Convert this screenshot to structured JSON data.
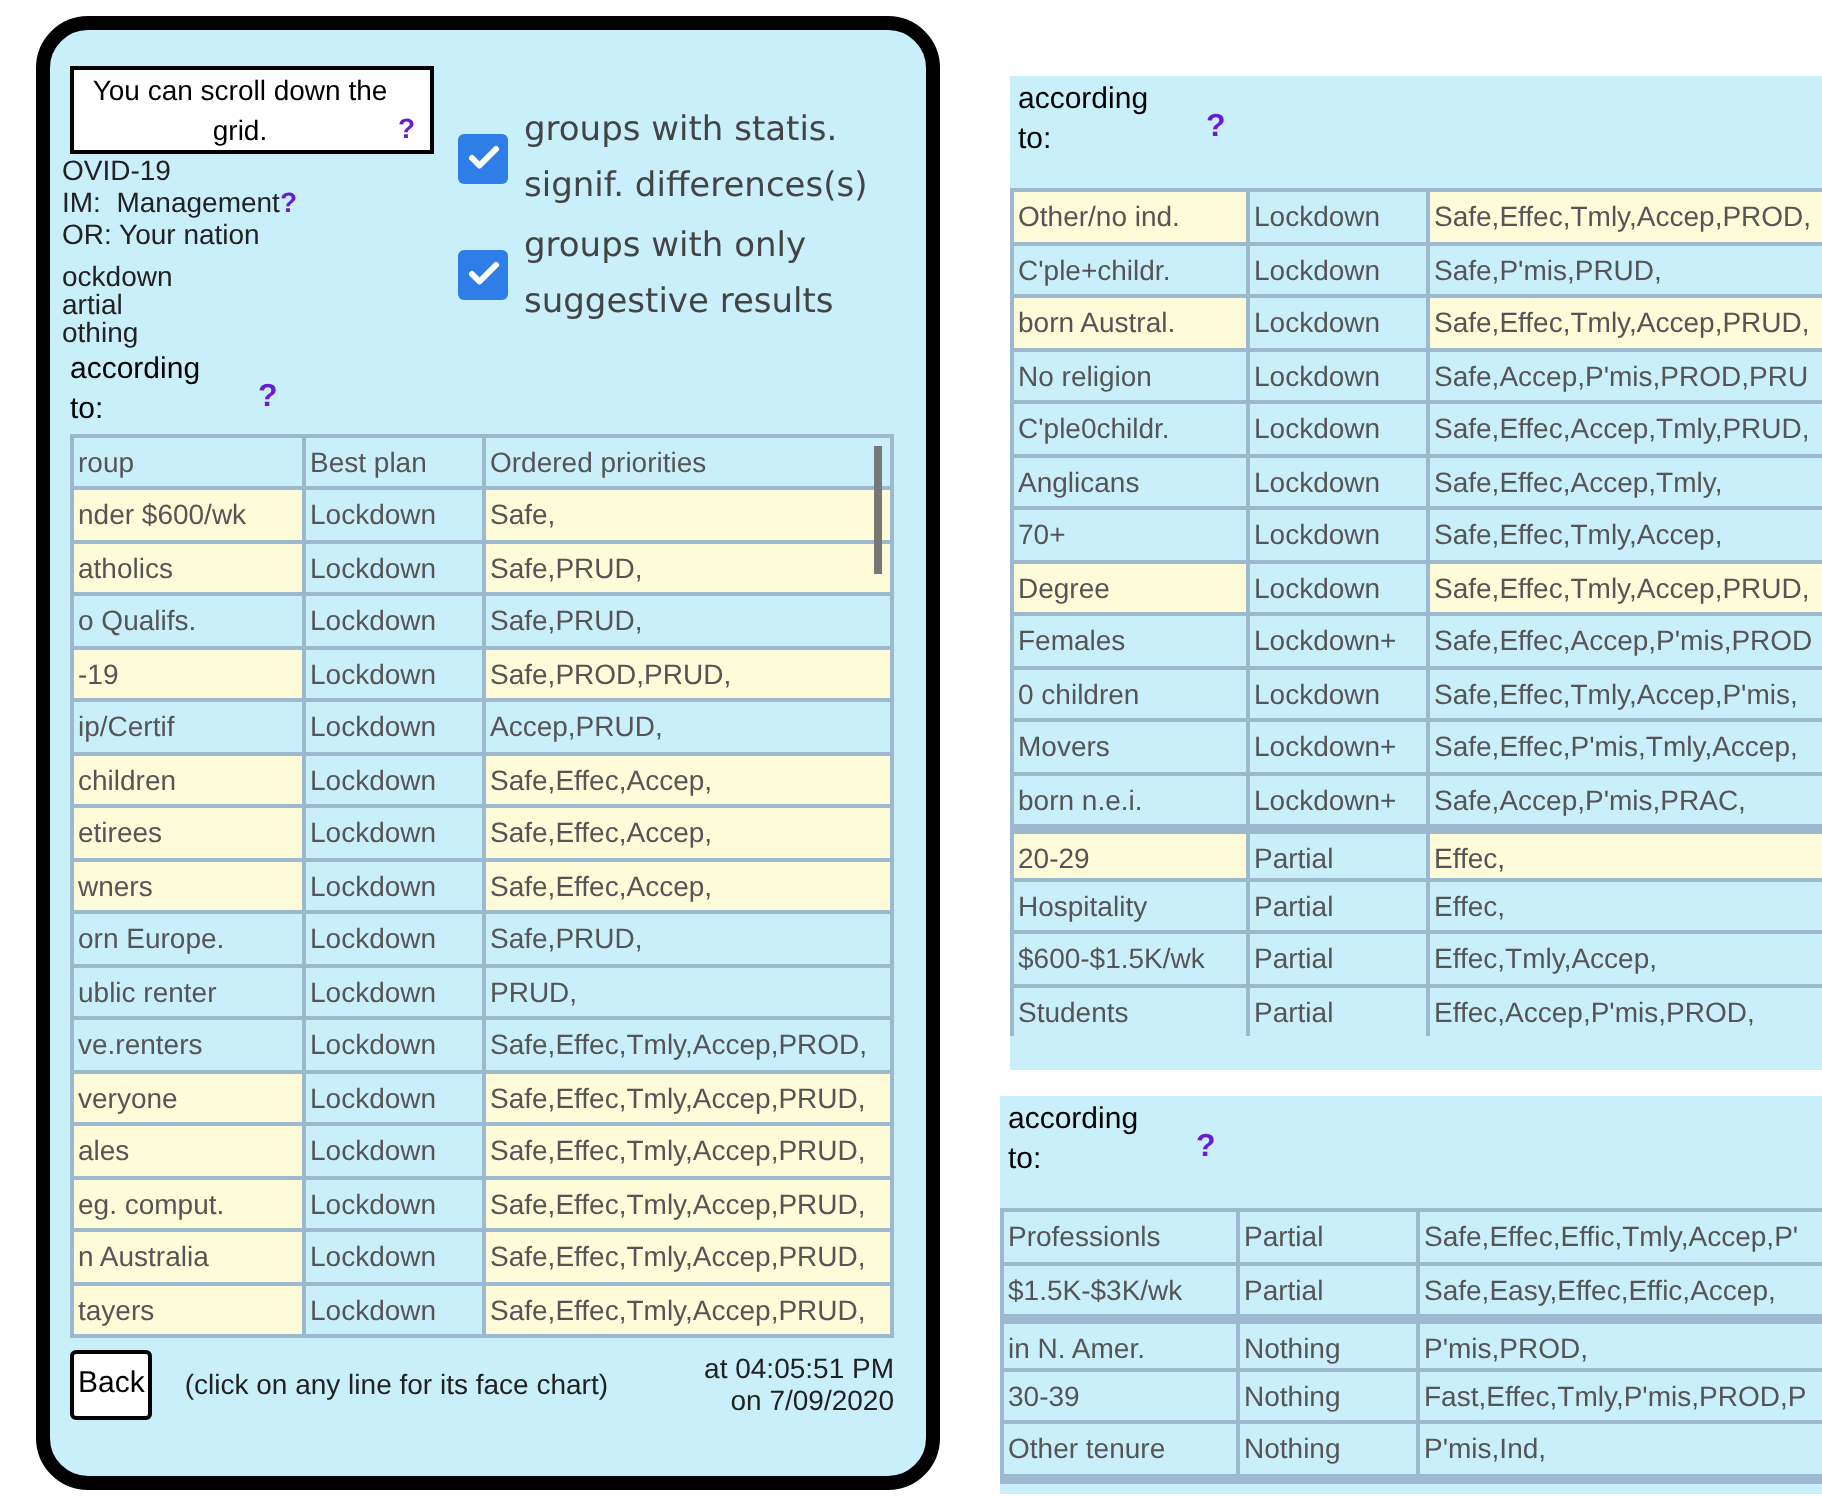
{
  "left_panel": {
    "notice": {
      "text": "You can scroll down the grid.",
      "help": "?"
    },
    "info": [
      {
        "text": "OVID-19"
      },
      {
        "text": "IM:  Management",
        "help": "?"
      },
      {
        "text": "OR: Your nation"
      }
    ],
    "plans": [
      "ockdown",
      "artial",
      "othing"
    ],
    "checkboxes": [
      {
        "label": "groups with statis. signif. differences(s)",
        "checked": true
      },
      {
        "label": "groups with only suggestive results",
        "checked": true
      }
    ],
    "according": {
      "text": "according to:",
      "help": "?"
    },
    "table": {
      "columns": [
        "roup",
        "Best plan",
        "Ordered priorities"
      ],
      "rows": [
        {
          "cells": [
            "nder $600/wk",
            "Lockdown",
            "Safe,"
          ],
          "highlighted": true
        },
        {
          "cells": [
            "atholics",
            "Lockdown",
            "Safe,PRUD,"
          ],
          "highlighted": true
        },
        {
          "cells": [
            "o Qualifs.",
            "Lockdown",
            "Safe,PRUD,"
          ],
          "highlighted": false
        },
        {
          "cells": [
            "-19",
            "Lockdown",
            "Safe,PROD,PRUD,"
          ],
          "highlighted": true
        },
        {
          "cells": [
            "ip/Certif",
            "Lockdown",
            "Accep,PRUD,"
          ],
          "highlighted": false
        },
        {
          "cells": [
            "children",
            "Lockdown",
            "Safe,Effec,Accep,"
          ],
          "highlighted": true
        },
        {
          "cells": [
            "etirees",
            "Lockdown",
            "Safe,Effec,Accep,"
          ],
          "highlighted": true
        },
        {
          "cells": [
            "wners",
            "Lockdown",
            "Safe,Effec,Accep,"
          ],
          "highlighted": true
        },
        {
          "cells": [
            "orn Europe.",
            "Lockdown",
            "Safe,PRUD,"
          ],
          "highlighted": false
        },
        {
          "cells": [
            "ublic renter",
            "Lockdown",
            "PRUD,"
          ],
          "highlighted": false
        },
        {
          "cells": [
            "ve.renters",
            "Lockdown",
            "Safe,Effec,Tmly,Accep,PROD,"
          ],
          "highlighted": false
        },
        {
          "cells": [
            "veryone",
            "Lockdown",
            "Safe,Effec,Tmly,Accep,PRUD,"
          ],
          "highlighted": true
        },
        {
          "cells": [
            "ales",
            "Lockdown",
            "Safe,Effec,Tmly,Accep,PRUD,"
          ],
          "highlighted": true
        },
        {
          "cells": [
            "eg. comput.",
            "Lockdown",
            "Safe,Effec,Tmly,Accep,PRUD,"
          ],
          "highlighted": true
        },
        {
          "cells": [
            "n Australia",
            "Lockdown",
            "Safe,Effec,Tmly,Accep,PRUD,"
          ],
          "highlighted": true
        },
        {
          "cells": [
            "tayers",
            "Lockdown",
            "Safe,Effec,Tmly,Accep,PRUD,"
          ],
          "highlighted": true
        }
      ]
    },
    "footer": {
      "button": "Back",
      "hint": "(click on any line for its face chart)",
      "time": "at 04:05:51 PM",
      "date": "on 7/09/2020"
    }
  },
  "right_top": {
    "according": {
      "text": "according to:",
      "help": "?"
    },
    "rows": [
      {
        "cells": [
          "Other/no ind.",
          "Lockdown",
          "Safe,Effec,Tmly,Accep,PROD,"
        ],
        "highlighted": true,
        "separator_before": false
      },
      {
        "cells": [
          "C'ple+childr.",
          "Lockdown",
          "Safe,P'mis,PRUD,"
        ],
        "highlighted": false,
        "separator_before": false
      },
      {
        "cells": [
          "born Austral.",
          "Lockdown",
          "Safe,Effec,Tmly,Accep,PRUD,"
        ],
        "highlighted": true,
        "separator_before": false
      },
      {
        "cells": [
          "No religion",
          "Lockdown",
          "Safe,Accep,P'mis,PROD,PRU"
        ],
        "highlighted": false,
        "separator_before": false
      },
      {
        "cells": [
          "C'ple0childr.",
          "Lockdown",
          "Safe,Effec,Accep,Tmly,PRUD,"
        ],
        "highlighted": false,
        "separator_before": false
      },
      {
        "cells": [
          "Anglicans",
          "Lockdown",
          "Safe,Effec,Accep,Tmly,"
        ],
        "highlighted": false,
        "separator_before": false
      },
      {
        "cells": [
          "70+",
          "Lockdown",
          "Safe,Effec,Tmly,Accep,"
        ],
        "highlighted": false,
        "separator_before": false
      },
      {
        "cells": [
          "Degree",
          "Lockdown",
          "Safe,Effec,Tmly,Accep,PRUD,"
        ],
        "highlighted": true,
        "separator_before": false
      },
      {
        "cells": [
          "Females",
          "Lockdown+",
          "Safe,Effec,Accep,P'mis,PROD"
        ],
        "highlighted": false,
        "separator_before": false
      },
      {
        "cells": [
          "0 children",
          "Lockdown",
          "Safe,Effec,Tmly,Accep,P'mis,"
        ],
        "highlighted": false,
        "separator_before": false
      },
      {
        "cells": [
          "Movers",
          "Lockdown+",
          "Safe,Effec,P'mis,Tmly,Accep,"
        ],
        "highlighted": false,
        "separator_before": false
      },
      {
        "cells": [
          "born n.e.i.",
          "Lockdown+",
          "Safe,Accep,P'mis,PRAC,"
        ],
        "highlighted": false,
        "separator_before": false
      },
      {
        "cells": [
          "20-29",
          "Partial",
          "Effec,"
        ],
        "highlighted": true,
        "separator_before": true
      },
      {
        "cells": [
          "Hospitality",
          "Partial",
          "Effec,"
        ],
        "highlighted": false,
        "separator_before": false
      },
      {
        "cells": [
          "$600-$1.5K/wk",
          "Partial",
          "Effec,Tmly,Accep,"
        ],
        "highlighted": false,
        "separator_before": false
      },
      {
        "cells": [
          "Students",
          "Partial",
          "Effec,Accep,P'mis,PROD,"
        ],
        "highlighted": false,
        "separator_before": false
      }
    ]
  },
  "right_bottom": {
    "according": {
      "text": "according to:",
      "help": "?"
    },
    "rows": [
      {
        "cells": [
          "Professionls",
          "Partial",
          "Safe,Effec,Effic,Tmly,Accep,P'"
        ],
        "highlighted": false,
        "separator_before": false
      },
      {
        "cells": [
          "$1.5K-$3K/wk",
          "Partial",
          "Safe,Easy,Effec,Effic,Accep,"
        ],
        "highlighted": false,
        "separator_before": false
      },
      {
        "cells": [
          "in N. Amer.",
          "Nothing",
          "P'mis,PROD,"
        ],
        "highlighted": false,
        "separator_before": true
      },
      {
        "cells": [
          "30-39",
          "Nothing",
          "Fast,Effec,Tmly,P'mis,PROD,P"
        ],
        "highlighted": false,
        "separator_before": false
      },
      {
        "cells": [
          "Other tenure",
          "Nothing",
          "P'mis,Ind,"
        ],
        "highlighted": false,
        "separator_before": false
      }
    ]
  }
}
